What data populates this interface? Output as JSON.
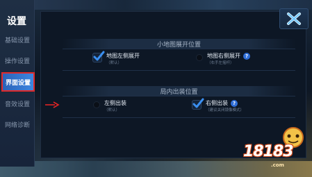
{
  "sidebar": {
    "title": "设置",
    "items": [
      {
        "label": "基础设置",
        "active": false
      },
      {
        "label": "操作设置",
        "active": false
      },
      {
        "label": "界面设置",
        "active": true
      },
      {
        "label": "音效设置",
        "active": false
      },
      {
        "label": "网络诊断",
        "active": false
      }
    ]
  },
  "sections": [
    {
      "title": "小地图展开位置",
      "options": [
        {
          "label": "地图左侧展开",
          "sub": "（默认）",
          "selected": true
        },
        {
          "label": "地图右侧展开",
          "sub": "（右手左摇杆）",
          "selected": false,
          "help": "?"
        }
      ]
    },
    {
      "title": "局内出装位置",
      "options": [
        {
          "label": "左侧出装",
          "sub": "（默认）",
          "selected": false
        },
        {
          "label": "右侧出装",
          "sub": "（建议关闭镜像模式）",
          "selected": true,
          "help": "?"
        }
      ]
    }
  ],
  "close": {
    "icon": "close-x-icon"
  },
  "colors": {
    "accent": "#3d86e0",
    "highlight": "#e12a2a",
    "check": "#3a8ff0"
  },
  "watermark": {
    "text": "18183",
    "sub": ".com"
  }
}
